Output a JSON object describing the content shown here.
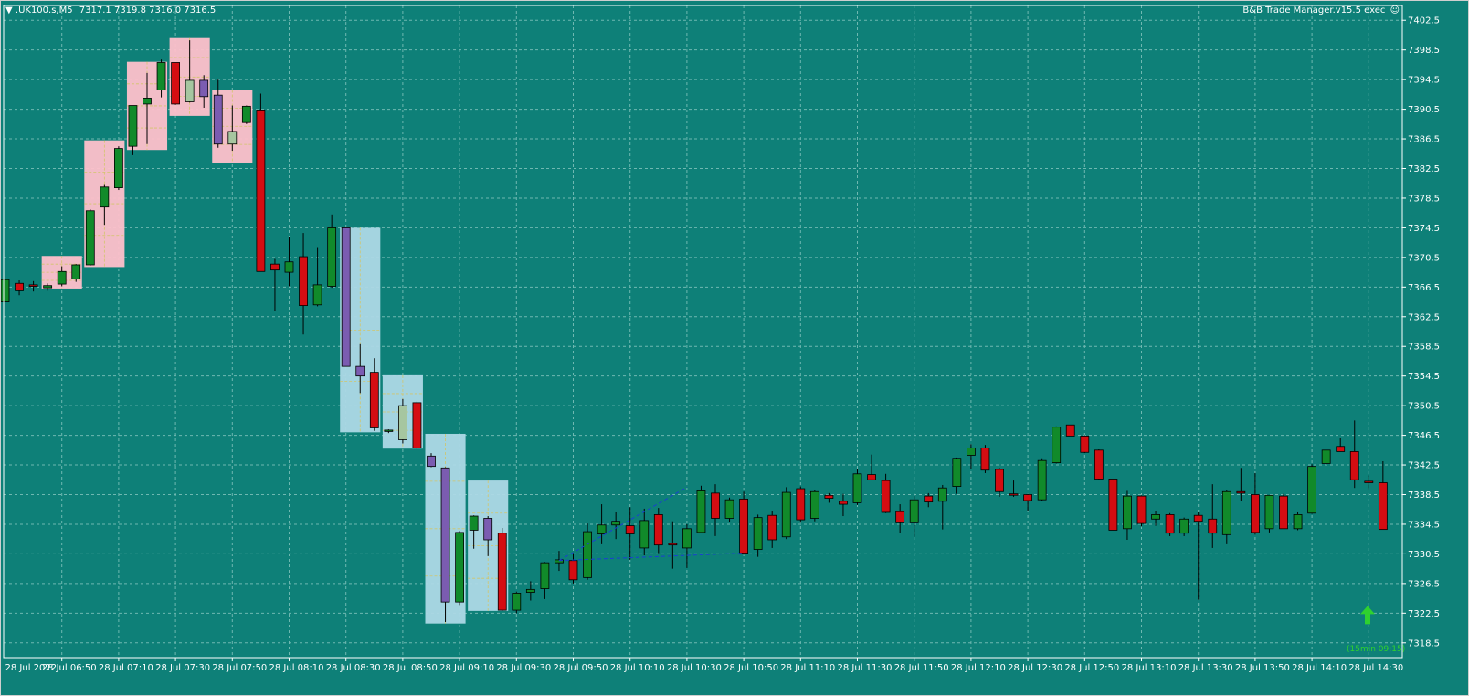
{
  "header": {
    "symbol_menu_icon": "triangle-down-icon",
    "symbol": ".UK100.s,M5",
    "ohlc": "7317.1 7319.8 7316.0 7316.5",
    "indicator": "B&B Trade Manager.v15.5 exec",
    "indicator_icon": "smiley-icon"
  },
  "countdown": "(15min 09:15)",
  "countdown_icon": "arrow-up-icon",
  "colors": {
    "background": "#0e8078",
    "grid": "#6fb8b1",
    "bull": "#118a2a",
    "bear": "#d40d12",
    "pink_zone": "#ffc0cb",
    "blue_zone": "#add8e6",
    "purple_body": "#7b5cb1",
    "arrow": "#2fd12f",
    "trend": "#1a3fd1"
  },
  "chart_data": {
    "type": "candlestick",
    "ylim": [
      7316.5,
      7404.5
    ],
    "y_ticks": [
      "7402.5",
      "7398.5",
      "7394.5",
      "7390.5",
      "7386.5",
      "7382.5",
      "7378.5",
      "7374.5",
      "7370.5",
      "7366.5",
      "7362.5",
      "7358.5",
      "7354.5",
      "7350.5",
      "7346.5",
      "7342.5",
      "7338.5",
      "7334.5",
      "7330.5",
      "7326.5",
      "7322.5",
      "7318.5"
    ],
    "x_ticks": [
      "28 Jul 2022",
      "28 Jul 06:50",
      "28 Jul 07:10",
      "28 Jul 07:30",
      "28 Jul 07:50",
      "28 Jul 08:10",
      "28 Jul 08:30",
      "28 Jul 08:50",
      "28 Jul 09:10",
      "28 Jul 09:30",
      "28 Jul 09:50",
      "28 Jul 10:10",
      "28 Jul 10:30",
      "28 Jul 10:50",
      "28 Jul 11:10",
      "28 Jul 11:30",
      "28 Jul 11:50",
      "28 Jul 12:10",
      "28 Jul 12:30",
      "28 Jul 12:50",
      "28 Jul 13:10",
      "28 Jul 13:30",
      "28 Jul 13:50",
      "28 Jul 14:10",
      "28 Jul 14:30"
    ],
    "candles": [
      {
        "o": 7364.5,
        "h": 7367.8,
        "l": 7364.2,
        "c": 7367.5
      },
      {
        "o": 7367.0,
        "h": 7367.4,
        "l": 7365.4,
        "c": 7366.0
      },
      {
        "o": 7366.8,
        "h": 7367.3,
        "l": 7365.9,
        "c": 7366.6
      },
      {
        "o": 7366.4,
        "h": 7367.0,
        "l": 7366.0,
        "c": 7366.7
      },
      {
        "o": 7366.9,
        "h": 7369.3,
        "l": 7366.6,
        "c": 7368.6
      },
      {
        "o": 7367.6,
        "h": 7369.6,
        "l": 7367.2,
        "c": 7369.5
      },
      {
        "o": 7369.5,
        "h": 7377.0,
        "l": 7369.4,
        "c": 7376.8
      },
      {
        "o": 7377.3,
        "h": 7380.4,
        "l": 7374.9,
        "c": 7380.0
      },
      {
        "o": 7379.9,
        "h": 7385.5,
        "l": 7379.6,
        "c": 7385.2
      },
      {
        "o": 7385.5,
        "h": 7391.0,
        "l": 7384.3,
        "c": 7391.0
      },
      {
        "o": 7391.2,
        "h": 7395.4,
        "l": 7385.8,
        "c": 7392.0
      },
      {
        "o": 7393.1,
        "h": 7397.2,
        "l": 7392.1,
        "c": 7396.8
      },
      {
        "o": 7396.8,
        "h": 7396.8,
        "l": 7391.1,
        "c": 7391.2
      },
      {
        "o": 7391.5,
        "h": 7399.8,
        "l": 7391.4,
        "c": 7394.4
      },
      {
        "o": 7394.4,
        "h": 7395.1,
        "l": 7390.7,
        "c": 7392.2
      },
      {
        "o": 7392.4,
        "h": 7394.5,
        "l": 7385.3,
        "c": 7385.8
      },
      {
        "o": 7385.8,
        "h": 7391.0,
        "l": 7384.9,
        "c": 7387.5
      },
      {
        "o": 7388.7,
        "h": 7391.0,
        "l": 7388.5,
        "c": 7390.9
      },
      {
        "o": 7390.4,
        "h": 7392.6,
        "l": 7368.6,
        "c": 7368.6
      },
      {
        "o": 7369.6,
        "h": 7370.3,
        "l": 7363.3,
        "c": 7368.8
      },
      {
        "o": 7368.5,
        "h": 7373.3,
        "l": 7366.6,
        "c": 7369.9
      },
      {
        "o": 7370.6,
        "h": 7373.8,
        "l": 7360.1,
        "c": 7364.0
      },
      {
        "o": 7364.1,
        "h": 7371.9,
        "l": 7363.9,
        "c": 7366.8
      },
      {
        "o": 7366.6,
        "h": 7376.3,
        "l": 7366.4,
        "c": 7374.5
      },
      {
        "o": 7374.5,
        "h": 7374.5,
        "l": 7355.8,
        "c": 7355.8
      },
      {
        "o": 7355.8,
        "h": 7358.8,
        "l": 7352.2,
        "c": 7354.5
      },
      {
        "o": 7355.0,
        "h": 7356.9,
        "l": 7347.1,
        "c": 7347.5
      },
      {
        "o": 7347.2,
        "h": 7347.3,
        "l": 7346.8,
        "c": 7347.2
      },
      {
        "o": 7345.9,
        "h": 7351.4,
        "l": 7345.4,
        "c": 7350.5
      },
      {
        "o": 7350.9,
        "h": 7351.1,
        "l": 7344.6,
        "c": 7344.8
      },
      {
        "o": 7343.7,
        "h": 7344.1,
        "l": 7342.2,
        "c": 7342.3
      },
      {
        "o": 7342.1,
        "h": 7342.2,
        "l": 7321.3,
        "c": 7324.0
      },
      {
        "o": 7324.0,
        "h": 7333.6,
        "l": 7323.6,
        "c": 7333.4
      },
      {
        "o": 7333.7,
        "h": 7335.7,
        "l": 7331.2,
        "c": 7335.6
      },
      {
        "o": 7335.3,
        "h": 7335.6,
        "l": 7330.2,
        "c": 7332.4
      },
      {
        "o": 7333.3,
        "h": 7334.0,
        "l": 7322.8,
        "c": 7322.9
      },
      {
        "o": 7322.9,
        "h": 7325.4,
        "l": 7322.5,
        "c": 7325.2
      },
      {
        "o": 7325.3,
        "h": 7326.8,
        "l": 7324.2,
        "c": 7325.7
      },
      {
        "o": 7325.8,
        "h": 7329.4,
        "l": 7324.4,
        "c": 7329.3
      },
      {
        "o": 7329.3,
        "h": 7330.9,
        "l": 7328.2,
        "c": 7329.7
      },
      {
        "o": 7329.6,
        "h": 7330.6,
        "l": 7326.5,
        "c": 7327.0
      },
      {
        "o": 7327.3,
        "h": 7334.6,
        "l": 7327.0,
        "c": 7333.5
      },
      {
        "o": 7333.2,
        "h": 7337.2,
        "l": 7331.8,
        "c": 7334.4
      },
      {
        "o": 7334.4,
        "h": 7336.1,
        "l": 7332.5,
        "c": 7334.9
      },
      {
        "o": 7334.3,
        "h": 7336.8,
        "l": 7329.7,
        "c": 7333.2
      },
      {
        "o": 7331.3,
        "h": 7336.6,
        "l": 7330.3,
        "c": 7335.0
      },
      {
        "o": 7335.8,
        "h": 7336.7,
        "l": 7330.6,
        "c": 7331.7
      },
      {
        "o": 7331.9,
        "h": 7334.9,
        "l": 7328.5,
        "c": 7331.7
      },
      {
        "o": 7331.3,
        "h": 7334.5,
        "l": 7328.6,
        "c": 7333.9
      },
      {
        "o": 7333.4,
        "h": 7339.7,
        "l": 7333.3,
        "c": 7339.0
      },
      {
        "o": 7338.7,
        "h": 7339.9,
        "l": 7332.9,
        "c": 7335.3
      },
      {
        "o": 7335.3,
        "h": 7338.1,
        "l": 7334.8,
        "c": 7337.8
      },
      {
        "o": 7337.9,
        "h": 7338.9,
        "l": 7330.4,
        "c": 7330.6
      },
      {
        "o": 7331.1,
        "h": 7335.8,
        "l": 7330.1,
        "c": 7335.4
      },
      {
        "o": 7335.7,
        "h": 7336.3,
        "l": 7331.3,
        "c": 7332.4
      },
      {
        "o": 7332.8,
        "h": 7339.5,
        "l": 7332.5,
        "c": 7338.8
      },
      {
        "o": 7339.3,
        "h": 7339.6,
        "l": 7334.7,
        "c": 7335.1
      },
      {
        "o": 7335.3,
        "h": 7339.1,
        "l": 7334.9,
        "c": 7338.9
      },
      {
        "o": 7338.4,
        "h": 7338.7,
        "l": 7337.4,
        "c": 7338.0
      },
      {
        "o": 7337.6,
        "h": 7338.6,
        "l": 7335.6,
        "c": 7337.2
      },
      {
        "o": 7337.4,
        "h": 7341.9,
        "l": 7337.1,
        "c": 7341.3
      },
      {
        "o": 7341.2,
        "h": 7343.9,
        "l": 7340.6,
        "c": 7340.5
      },
      {
        "o": 7340.4,
        "h": 7341.3,
        "l": 7336.0,
        "c": 7336.1
      },
      {
        "o": 7336.2,
        "h": 7337.2,
        "l": 7333.3,
        "c": 7334.7
      },
      {
        "o": 7334.7,
        "h": 7338.3,
        "l": 7332.8,
        "c": 7337.8
      },
      {
        "o": 7338.3,
        "h": 7338.7,
        "l": 7336.8,
        "c": 7337.5
      },
      {
        "o": 7337.6,
        "h": 7339.8,
        "l": 7333.8,
        "c": 7339.4
      },
      {
        "o": 7339.6,
        "h": 7343.5,
        "l": 7338.6,
        "c": 7343.4
      },
      {
        "o": 7343.8,
        "h": 7345.3,
        "l": 7341.9,
        "c": 7344.8
      },
      {
        "o": 7344.8,
        "h": 7345.2,
        "l": 7341.4,
        "c": 7341.8
      },
      {
        "o": 7341.9,
        "h": 7342.1,
        "l": 7338.2,
        "c": 7338.9
      },
      {
        "o": 7338.6,
        "h": 7340.4,
        "l": 7338.2,
        "c": 7338.5
      },
      {
        "o": 7338.5,
        "h": 7338.6,
        "l": 7336.3,
        "c": 7337.7
      },
      {
        "o": 7337.8,
        "h": 7343.4,
        "l": 7337.7,
        "c": 7343.1
      },
      {
        "o": 7342.8,
        "h": 7347.7,
        "l": 7342.7,
        "c": 7347.6
      },
      {
        "o": 7347.9,
        "h": 7347.9,
        "l": 7346.4,
        "c": 7346.4
      },
      {
        "o": 7346.4,
        "h": 7346.5,
        "l": 7344.1,
        "c": 7344.2
      },
      {
        "o": 7344.5,
        "h": 7344.6,
        "l": 7340.5,
        "c": 7340.6
      },
      {
        "o": 7340.6,
        "h": 7340.6,
        "l": 7333.7,
        "c": 7333.7
      },
      {
        "o": 7333.9,
        "h": 7339.0,
        "l": 7332.4,
        "c": 7338.3
      },
      {
        "o": 7338.3,
        "h": 7338.4,
        "l": 7334.2,
        "c": 7334.6
      },
      {
        "o": 7335.2,
        "h": 7336.3,
        "l": 7334.3,
        "c": 7335.8
      },
      {
        "o": 7335.8,
        "h": 7336.0,
        "l": 7332.9,
        "c": 7333.3
      },
      {
        "o": 7333.3,
        "h": 7335.4,
        "l": 7332.9,
        "c": 7335.2
      },
      {
        "o": 7335.7,
        "h": 7336.1,
        "l": 7324.3,
        "c": 7334.9
      },
      {
        "o": 7335.2,
        "h": 7339.9,
        "l": 7331.3,
        "c": 7333.3
      },
      {
        "o": 7333.1,
        "h": 7339.1,
        "l": 7331.8,
        "c": 7338.9
      },
      {
        "o": 7338.9,
        "h": 7342.1,
        "l": 7337.7,
        "c": 7338.7
      },
      {
        "o": 7338.5,
        "h": 7341.4,
        "l": 7333.1,
        "c": 7333.4
      },
      {
        "o": 7333.9,
        "h": 7338.4,
        "l": 7333.4,
        "c": 7338.4
      },
      {
        "o": 7338.3,
        "h": 7338.6,
        "l": 7333.9,
        "c": 7333.9
      },
      {
        "o": 7333.9,
        "h": 7336.1,
        "l": 7333.7,
        "c": 7335.8
      },
      {
        "o": 7336.0,
        "h": 7342.6,
        "l": 7335.9,
        "c": 7342.3
      },
      {
        "o": 7342.7,
        "h": 7344.3,
        "l": 7342.5,
        "c": 7344.5
      },
      {
        "o": 7345.0,
        "h": 7346.1,
        "l": 7344.3,
        "c": 7344.3
      },
      {
        "o": 7344.3,
        "h": 7348.5,
        "l": 7339.4,
        "c": 7340.5
      },
      {
        "o": 7340.3,
        "h": 7341.1,
        "l": 7339.2,
        "c": 7340.1
      },
      {
        "o": 7340.1,
        "h": 7343.0,
        "l": 7335.4,
        "c": 7333.8
      }
    ],
    "pink_zones": [
      {
        "from": 3,
        "to": 5,
        "top": 7370.7,
        "bottom": 7366.3
      },
      {
        "from": 6,
        "to": 8,
        "top": 7386.3,
        "bottom": 7369.2
      },
      {
        "from": 9,
        "to": 11,
        "top": 7396.9,
        "bottom": 7385.0
      },
      {
        "from": 12,
        "to": 14,
        "top": 7400.1,
        "bottom": 7389.6
      },
      {
        "from": 15,
        "to": 17,
        "top": 7393.1,
        "bottom": 7383.3
      }
    ],
    "blue_zones": [
      {
        "from": 24,
        "to": 26,
        "top": 7374.5,
        "bottom": 7346.9
      },
      {
        "from": 27,
        "to": 29,
        "top": 7354.6,
        "bottom": 7344.7
      },
      {
        "from": 30,
        "to": 32,
        "top": 7346.7,
        "bottom": 7321.1
      },
      {
        "from": 33,
        "to": 35,
        "top": 7340.4,
        "bottom": 7322.8
      }
    ],
    "overlay_candles": [
      13,
      14,
      15,
      16,
      24,
      25,
      28,
      30,
      31,
      34
    ],
    "trendlines": [
      {
        "from": 39,
        "y1": 7329.6,
        "to": 48,
        "y2": 7339.5
      },
      {
        "from": 39,
        "y1": 7329.6,
        "to": 52,
        "y2": 7330.6
      }
    ],
    "arrow_price": 7322.0
  }
}
